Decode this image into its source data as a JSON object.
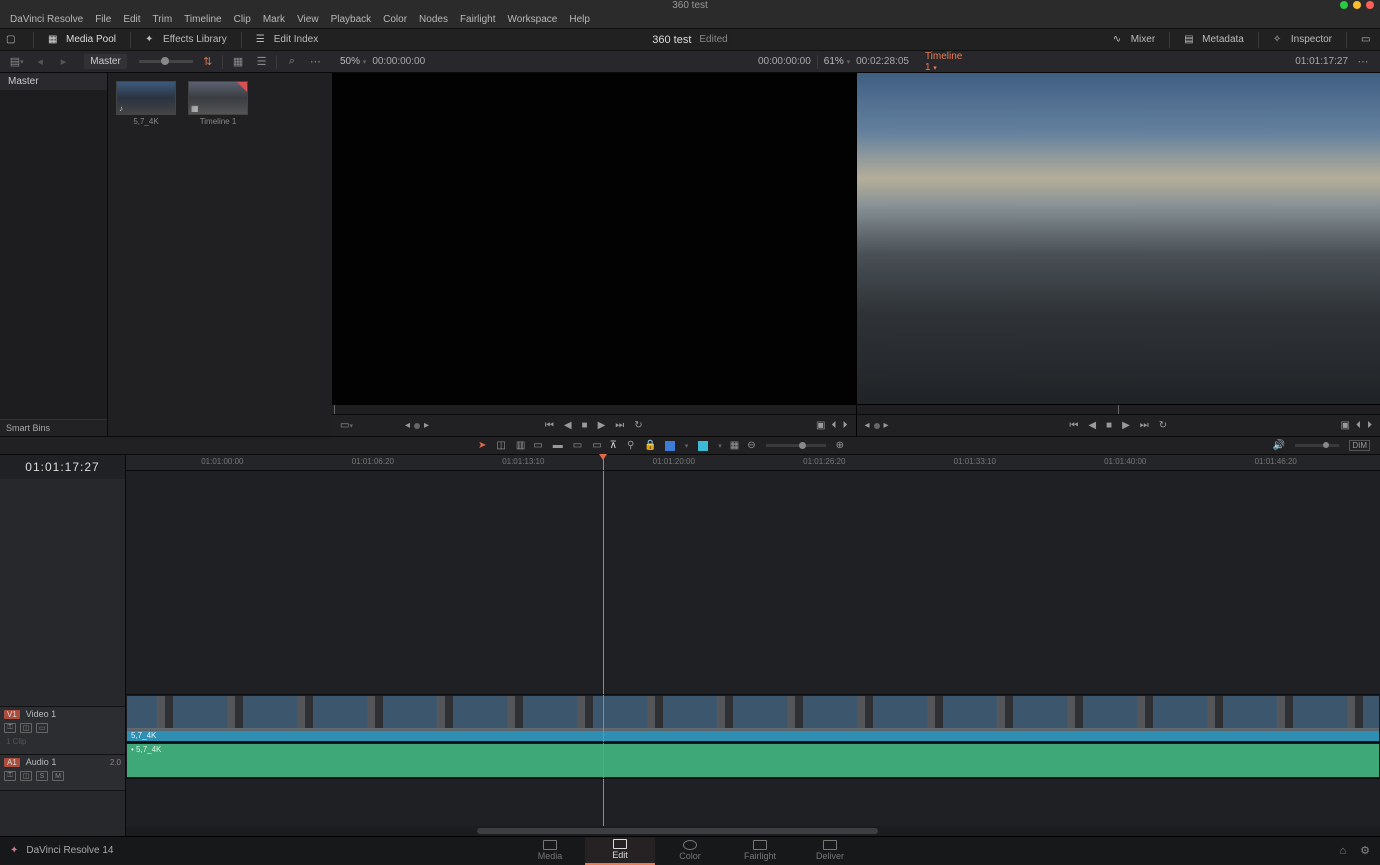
{
  "window": {
    "title": "360 test"
  },
  "menus": [
    "DaVinci Resolve",
    "File",
    "Edit",
    "Trim",
    "Timeline",
    "Clip",
    "Mark",
    "View",
    "Playback",
    "Color",
    "Nodes",
    "Fairlight",
    "Workspace",
    "Help"
  ],
  "toolbar": {
    "media_pool": "Media Pool",
    "effects_library": "Effects Library",
    "edit_index": "Edit Index",
    "mixer": "Mixer",
    "metadata": "Metadata",
    "inspector": "Inspector"
  },
  "project": {
    "name": "360 test",
    "status": "Edited"
  },
  "bin": {
    "current": "Master",
    "items": [
      "Master"
    ],
    "smart_label": "Smart Bins"
  },
  "pool_items": [
    {
      "label": "5,7_4K"
    },
    {
      "label": "Timeline 1"
    }
  ],
  "source_viewer": {
    "zoom": "50%",
    "tc": "00:00:00:00",
    "in_tc": "00:00:00:00",
    "dur": "",
    "match": ""
  },
  "program_viewer": {
    "zoom": "61%",
    "dur": "00:02:28:05",
    "tc": "01:01:17:27"
  },
  "timeline_label": {
    "name": "Timeline 1"
  },
  "timeline": {
    "tc_display": "01:01:17:27",
    "ruler": [
      "01:01:00:00",
      "01:01:06:20",
      "01:01:13:10",
      "01:01:20:00",
      "01:01:26:20",
      "01:01:33:10",
      "01:01:40:00",
      "01:01:46:20"
    ],
    "playhead_pct": 38,
    "video": {
      "badge": "V1",
      "name": "Video 1",
      "clips_label": "1 Clip",
      "clip_name": "5,7_4K"
    },
    "audio": {
      "badge": "A1",
      "name": "Audio 1",
      "ch": "2.0",
      "clip_name": "5,7_4K"
    }
  },
  "nav": {
    "tabs": [
      "Media",
      "Edit",
      "Color",
      "Fairlight",
      "Deliver"
    ],
    "active": 1,
    "app": "DaVinci Resolve 14"
  }
}
